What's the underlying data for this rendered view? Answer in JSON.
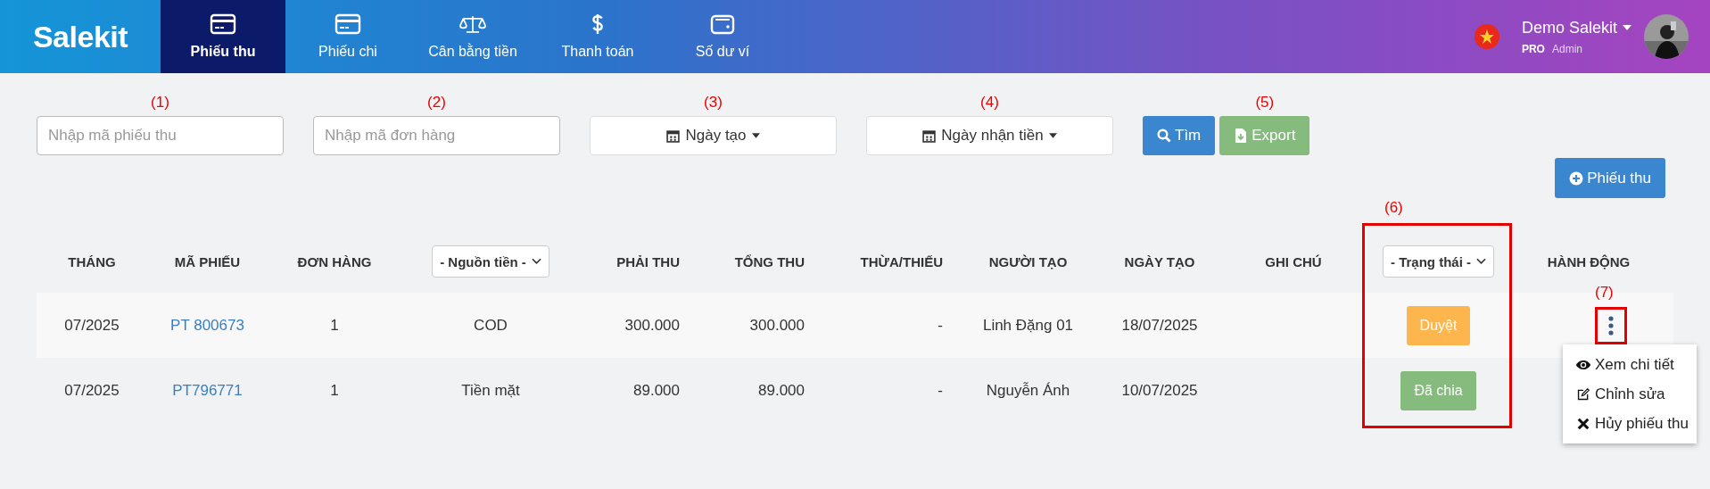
{
  "brand": "Salekit",
  "nav": [
    {
      "label": "Phiếu thu",
      "selected": true
    },
    {
      "label": "Phiếu chi",
      "selected": false
    },
    {
      "label": "Cân bằng tiền",
      "selected": false
    },
    {
      "label": "Thanh toán",
      "selected": false
    },
    {
      "label": "Số dư ví",
      "selected": false
    }
  ],
  "user": {
    "name": "Demo Salekit",
    "plan": "PRO",
    "role": "Admin"
  },
  "filters": [
    {
      "kind": "input",
      "marker": "(1)",
      "placeholder": "Nhập mã phiếu thu"
    },
    {
      "kind": "input",
      "marker": "(2)",
      "placeholder": "Nhập mã đơn hàng"
    },
    {
      "kind": "date",
      "marker": "(3)",
      "label": "Ngày tạo"
    },
    {
      "kind": "date",
      "marker": "(4)",
      "label": "Ngày nhận tiền"
    }
  ],
  "actions": [
    {
      "kind": "search",
      "label": "Tìm"
    },
    {
      "kind": "export",
      "label": "Export",
      "marker": "(5)"
    }
  ],
  "add_button": "Phiếu thu",
  "columns": [
    {
      "kind": "text",
      "label": "THÁNG"
    },
    {
      "kind": "text",
      "label": "MÃ PHIẾU"
    },
    {
      "kind": "text",
      "label": "ĐƠN HÀNG"
    },
    {
      "kind": "select",
      "label": "- Nguồn tiền -"
    },
    {
      "kind": "text",
      "label": "PHẢI THU"
    },
    {
      "kind": "text",
      "label": "TỔNG THU"
    },
    {
      "kind": "text",
      "label": "THỪA/THIẾU"
    },
    {
      "kind": "text",
      "label": "NGƯỜI TẠO"
    },
    {
      "kind": "text",
      "label": "NGÀY TẠO"
    },
    {
      "kind": "text",
      "label": "GHI CHÚ"
    },
    {
      "kind": "select",
      "label": "- Trạng thái -",
      "marker": "(6)"
    },
    {
      "kind": "text",
      "label": "HÀNH ĐỘNG"
    }
  ],
  "rows": [
    {
      "month": "07/2025",
      "code": "PT 800673",
      "orders": "1",
      "source": "COD",
      "due": "300.000",
      "total": "300.000",
      "diff": "-",
      "creator": "Linh Đặng 01",
      "date": "18/07/2025",
      "status": {
        "label": "Duyệt",
        "color": "#fdb54e"
      },
      "action_marker": "(7)"
    },
    {
      "month": "07/2025",
      "code": "PT796771",
      "orders": "1",
      "source": "Tiền mặt",
      "due": "89.000",
      "total": "89.000",
      "diff": "-",
      "creator": "Nguyễn Ánh",
      "date": "10/07/2025",
      "status": {
        "label": "Đã chia",
        "color": "#86bb7e"
      }
    }
  ],
  "menu": [
    {
      "label": "Xem chi tiết"
    },
    {
      "label": "Chỉnh sửa"
    },
    {
      "label": "Hủy phiếu thu"
    }
  ]
}
